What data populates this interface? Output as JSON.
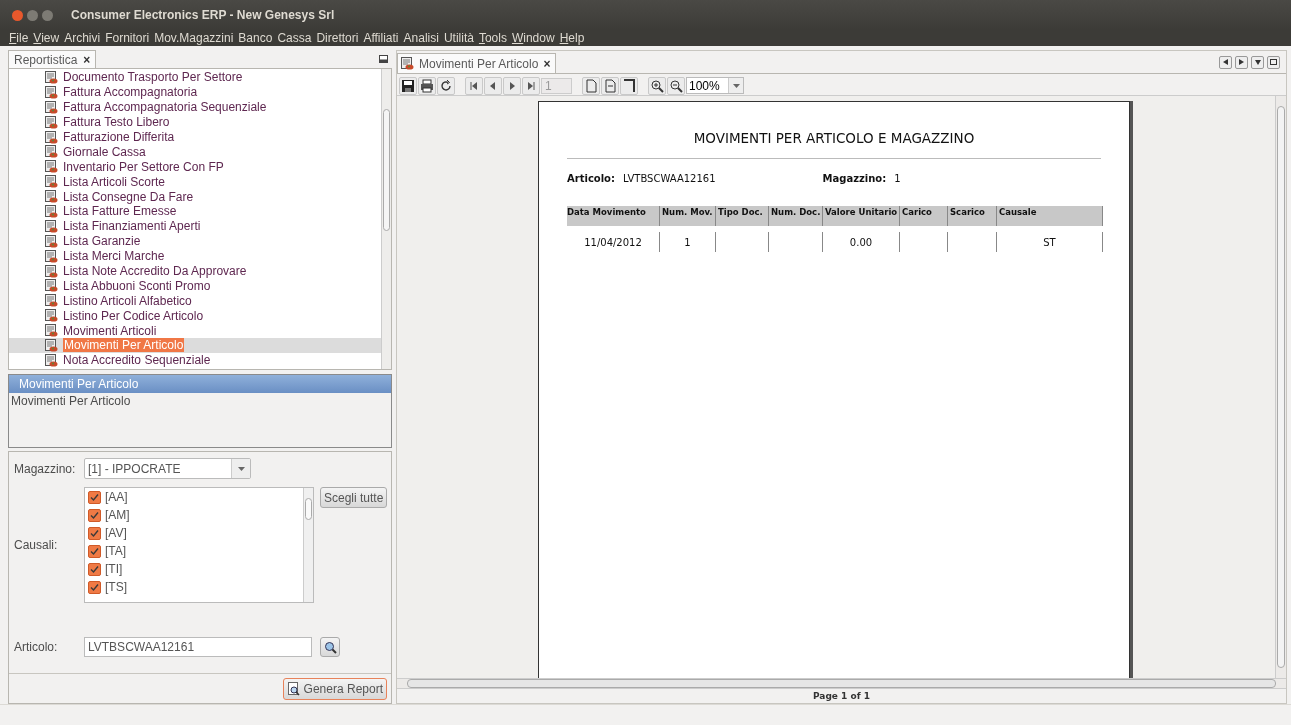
{
  "window": {
    "title": "Consumer Electronics ERP - New Genesys Srl"
  },
  "menu": [
    {
      "label": "File",
      "underlined": true
    },
    {
      "label": "View",
      "underlined": true
    },
    {
      "label": "Archivi",
      "underlined": false
    },
    {
      "label": "Fornitori",
      "underlined": false
    },
    {
      "label": "Mov.Magazzini",
      "underlined": false
    },
    {
      "label": "Banco",
      "underlined": false
    },
    {
      "label": "Cassa",
      "underlined": false
    },
    {
      "label": "Direttori",
      "underlined": false
    },
    {
      "label": "Affiliati",
      "underlined": false
    },
    {
      "label": "Analisi",
      "underlined": false
    },
    {
      "label": "Utilità",
      "underlined": false
    },
    {
      "label": "Tools",
      "underlined": true
    },
    {
      "label": "Window",
      "underlined": true
    },
    {
      "label": "Help",
      "underlined": true
    }
  ],
  "left_panel": {
    "tab": {
      "label": "Reportistica",
      "close": "×",
      "selected": true
    },
    "tree_items": [
      {
        "label": "Documento Trasporto Per Settore",
        "selected": false
      },
      {
        "label": "Fattura Accompagnatoria",
        "selected": false
      },
      {
        "label": "Fattura Accompagnatoria Sequenziale",
        "selected": false
      },
      {
        "label": "Fattura Testo Libero",
        "selected": false
      },
      {
        "label": "Fatturazione Differita",
        "selected": false
      },
      {
        "label": "Giornale Cassa",
        "selected": false
      },
      {
        "label": "Inventario Per Settore Con FP",
        "selected": false
      },
      {
        "label": "Lista Articoli Scorte",
        "selected": false
      },
      {
        "label": "Lista Consegne Da Fare",
        "selected": false
      },
      {
        "label": "Lista Fatture Emesse",
        "selected": false
      },
      {
        "label": "Lista Finanziamenti Aperti",
        "selected": false
      },
      {
        "label": "Lista Garanzie",
        "selected": false
      },
      {
        "label": "Lista Merci Marche",
        "selected": false
      },
      {
        "label": "Lista Note Accredito Da Approvare",
        "selected": false
      },
      {
        "label": "Lista Abbuoni Sconti Promo",
        "selected": false
      },
      {
        "label": "Listino Articoli Alfabetico",
        "selected": false
      },
      {
        "label": "Listino Per Codice Articolo",
        "selected": false
      },
      {
        "label": "Movimenti Articoli",
        "selected": false
      },
      {
        "label": "Movimenti Per Articolo",
        "selected": true
      },
      {
        "label": "Nota Accredito Sequenziale",
        "selected": false
      }
    ],
    "description": {
      "header": "Movimenti Per Articolo",
      "text": "Movimenti Per Articolo"
    },
    "form": {
      "magazzino": {
        "label": "Magazzino:",
        "value": "[1] - IPPOCRATE"
      },
      "causali": {
        "label": "Causali:",
        "items": [
          {
            "label": "[AA]",
            "checked": true
          },
          {
            "label": "[AM]",
            "checked": true
          },
          {
            "label": "[AV]",
            "checked": true
          },
          {
            "label": "[TA]",
            "checked": true
          },
          {
            "label": "[TI]",
            "checked": true
          },
          {
            "label": "[TS]",
            "checked": true
          }
        ],
        "select_all_button": "Scegli tutte"
      },
      "articolo": {
        "label": "Articolo:",
        "value": "LVTBSCWAA12161"
      },
      "generate_button": "Genera Report"
    }
  },
  "right_panel": {
    "tab": {
      "label": "Movimenti Per Articolo",
      "close": "×",
      "selected": true
    },
    "toolbar": {
      "page_field": {
        "value": "1",
        "disabled": true
      },
      "zoom": "100%"
    },
    "report": {
      "title": "MOVIMENTI PER ARTICOLO E MAGAZZINO",
      "articolo_label": "Articolo:",
      "articolo_value": "LVTBSCWAA12161",
      "magazzino_label": "Magazzino:",
      "magazzino_value": "1",
      "columns": [
        "Data Movimento",
        "Num. Mov.",
        "Tipo Doc.",
        "Num. Doc.",
        "Valore Unitario",
        "Carico",
        "Scarico",
        "Causale"
      ],
      "rows": [
        [
          "11/04/2012",
          "1",
          "",
          "",
          "0.00",
          "",
          "",
          "ST"
        ]
      ]
    },
    "page_indicator": "Page 1 of 1"
  }
}
